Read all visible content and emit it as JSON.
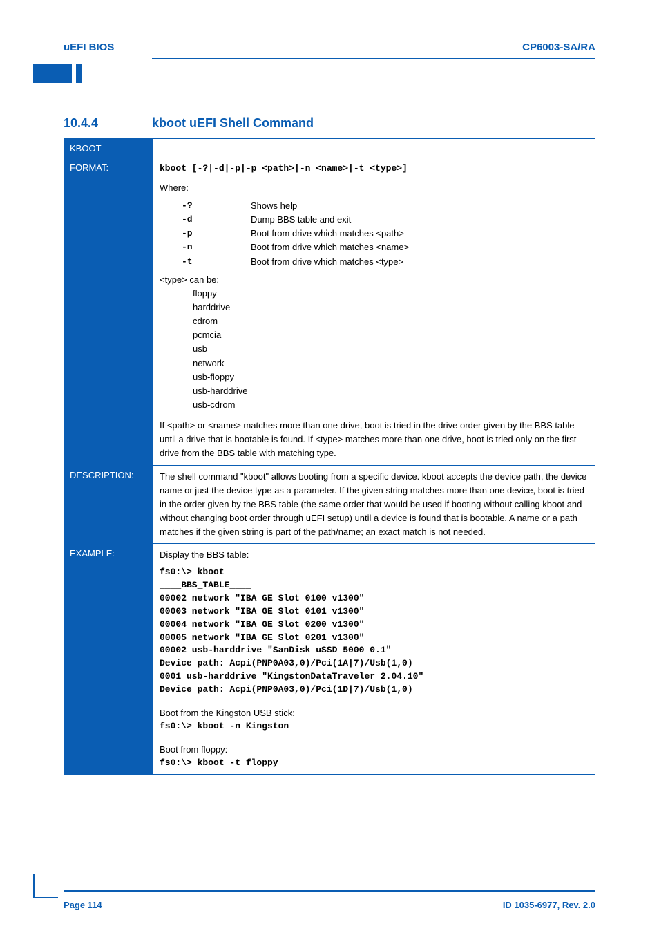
{
  "header": {
    "left": "uEFI BIOS",
    "right": "CP6003-SA/RA"
  },
  "section": {
    "number": "10.4.4",
    "title": "kboot uEFI Shell Command"
  },
  "rows": {
    "kboot_label": "KBOOT",
    "format_label": "FORMAT:",
    "format_code": "kboot [-?|-d|-p|-p <path>|-n <name>|-t <type>]",
    "format_intro": "Where:",
    "options": [
      {
        "k": "-?",
        "v": "Shows help"
      },
      {
        "k": "-d",
        "v": "Dump BBS table and exit"
      },
      {
        "k": "-p",
        "v": "Boot from drive which matches <path>"
      },
      {
        "k": "-n",
        "v": "Boot from drive which matches <name>"
      },
      {
        "k": "-t",
        "v": "Boot from drive which matches <type>"
      }
    ],
    "type_intro": "<type> can be:",
    "types": [
      "floppy",
      "harddrive",
      "cdrom",
      "pcmcia",
      "usb",
      "network",
      "usb-floppy",
      "usb-harddrive",
      "usb-cdrom"
    ],
    "note": "If <path> or <name> matches more than one drive, boot is tried in the drive order given by the BBS table until a drive that is bootable is found. If <type> matches more than one drive, boot is tried only on the first drive from the BBS table with matching type.",
    "desc_label": "DESCRIPTION:",
    "desc_text": "The shell command \"kboot\" allows booting from a specific device. kboot accepts the device path, the device name or just the device type as a parameter. If the given string matches more than one device, boot is tried in the order given by the BBS table (the same order that would be used if booting without calling kboot and without changing boot order through uEFI setup) until a device is found that is bootable. A name or a path matches if the given string is part of the path/name; an exact match is not needed.",
    "ex_label": "EXAMPLE:",
    "ex_intro": "Display the BBS table:",
    "ex_block": "fs0:\\> kboot\n____BBS_TABLE____\n00002 network \"IBA GE Slot 0100 v1300\"\n00003 network \"IBA GE Slot 0101 v1300\"\n00004 network \"IBA GE Slot 0200 v1300\"\n00005 network \"IBA GE Slot 0201 v1300\"\n00002 usb-harddrive \"SanDisk uSSD 5000 0.1\"\nDevice path: Acpi(PNP0A03,0)/Pci(1A|7)/Usb(1,0)\n0001 usb-harddrive \"KingstonDataTraveler 2.04.10\"\nDevice path: Acpi(PNP0A03,0)/Pci(1D|7)/Usb(1,0)",
    "ex2_intro": "Boot from the Kingston USB stick:",
    "ex2_code": "fs0:\\> kboot -n Kingston",
    "ex3_intro": "Boot from floppy:",
    "ex3_code": "fs0:\\> kboot -t floppy"
  },
  "footer": {
    "left": "Page 114",
    "right": "ID 1035-6977, Rev. 2.0"
  }
}
